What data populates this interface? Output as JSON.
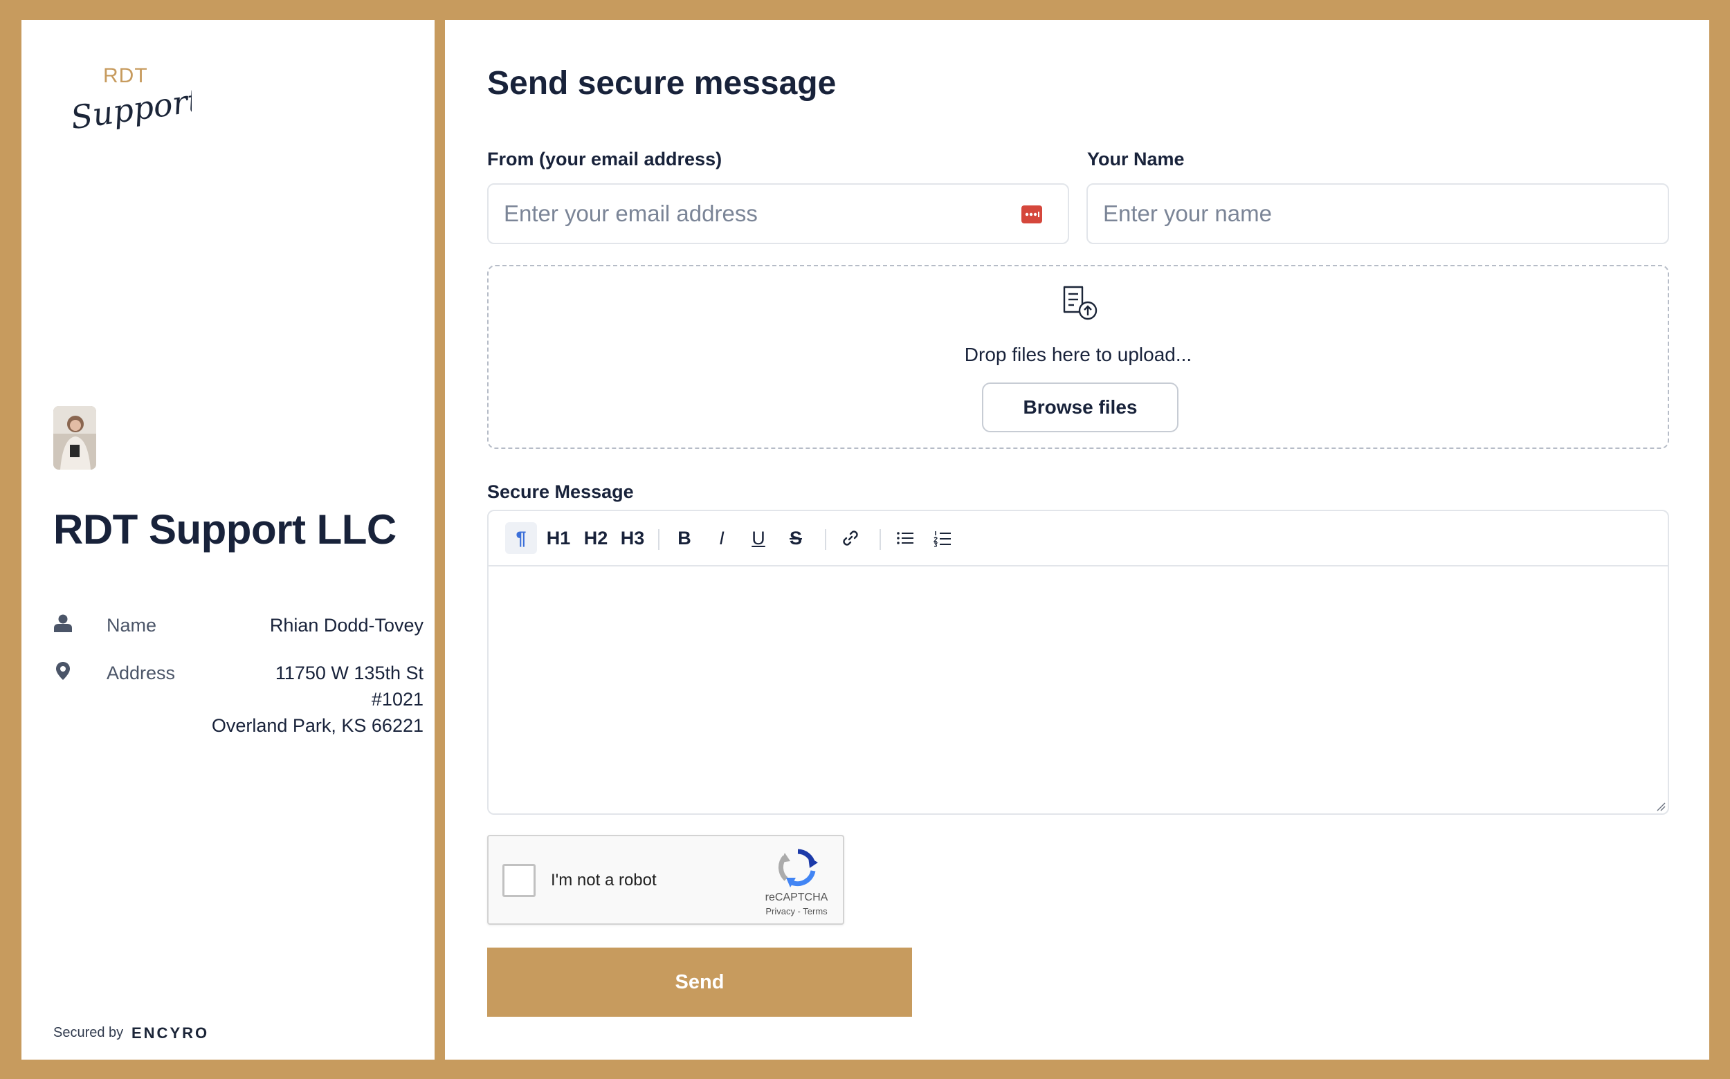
{
  "sidebar": {
    "logo": {
      "top_text": "RDT",
      "script_text": "Support"
    },
    "company_name": "RDT Support LLC",
    "name_label": "Name",
    "name_value": "Rhian Dodd-Tovey",
    "address_label": "Address",
    "address_line1": "11750 W 135th St",
    "address_line2": "#1021",
    "address_line3": "Overland Park, KS 66221",
    "secured_by": "Secured by",
    "provider_logo": "ENCYRO"
  },
  "form": {
    "title": "Send secure message",
    "email_label": "From (your email address)",
    "email_placeholder": "Enter your email address",
    "email_value": "",
    "name_label": "Your Name",
    "name_placeholder": "Enter your name",
    "name_value": "",
    "dropzone_text": "Drop files here to upload...",
    "browse_label": "Browse files",
    "message_label": "Secure Message",
    "message_value": "",
    "toolbar": {
      "paragraph": "¶",
      "h1": "H1",
      "h2": "H2",
      "h3": "H3",
      "bold": "B",
      "italic": "I",
      "underline": "U",
      "strike": "S"
    },
    "captcha": {
      "label": "I'm not a robot",
      "brand": "reCAPTCHA",
      "links": "Privacy - Terms"
    },
    "send_label": "Send"
  },
  "colors": {
    "accent": "#C79B5E",
    "text_dark": "#18223a",
    "border": "#e2e5ea",
    "link_active": "#3b6fd9"
  }
}
